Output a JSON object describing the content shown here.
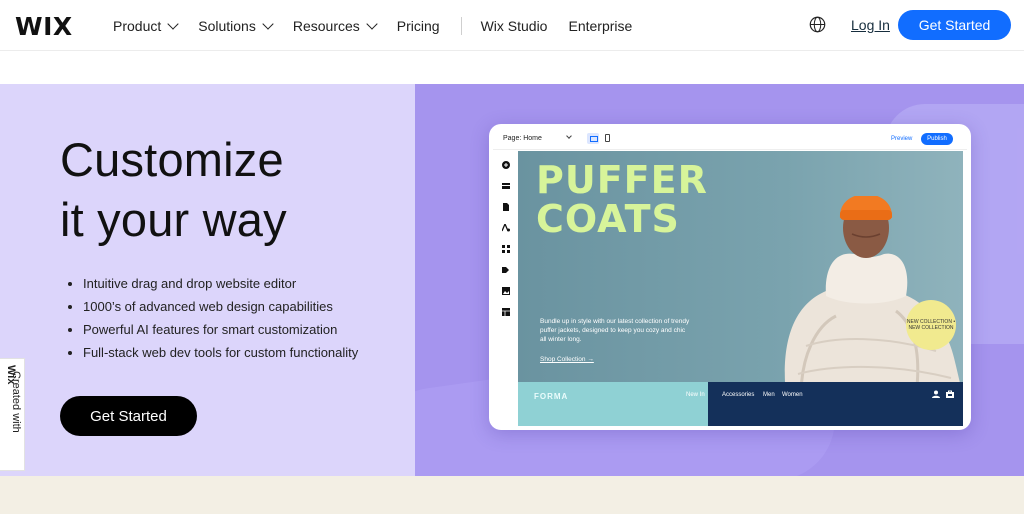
{
  "header": {
    "logo": "WIX",
    "nav": [
      {
        "label": "Product",
        "has_menu": true
      },
      {
        "label": "Solutions",
        "has_menu": true
      },
      {
        "label": "Resources",
        "has_menu": true
      },
      {
        "label": "Pricing",
        "has_menu": false
      }
    ],
    "nav_secondary": [
      "Wix Studio",
      "Enterprise"
    ],
    "globe_icon": "globe-icon",
    "login_label": "Log In",
    "cta_label": "Get Started"
  },
  "hero": {
    "headline_line1": "Customize",
    "headline_line2": "it your way",
    "bullets": [
      "Intuitive drag and drop website editor",
      "1000’s of advanced web design capabilities",
      "Powerful AI features for smart customization",
      "Full-stack web dev tools for custom functionality"
    ],
    "cta_label": "Get Started"
  },
  "side_tab": {
    "prefix": "Created with ",
    "brand": "Wix"
  },
  "editor": {
    "page_label": "Page: Home",
    "preview_label": "Preview",
    "publish_label": "Publish",
    "tool_icons": [
      "add-icon",
      "section-icon",
      "page-icon",
      "text-style-icon",
      "apps-icon",
      "business-icon",
      "media-icon",
      "table-icon"
    ],
    "site": {
      "headline_line1": "PUFFER",
      "headline_line2": "COATS",
      "blurb": "Bundle up in style with our latest collection of trendy puffer jackets, designed to keep you cozy and chic all winter long.",
      "shop_link": "Shop Collection →",
      "badge_text": "NEW COLLECTION • NEW COLLECTION",
      "brand": "FORMA",
      "nav": [
        "New In",
        "Accessories",
        "Men",
        "Women"
      ]
    }
  },
  "colors": {
    "accent": "#116dff",
    "hero_left": "#dcd5fb",
    "hero_right": "#a594ee",
    "puffer_text": "#d7f49a",
    "site_nav_bg": "#14305a"
  }
}
